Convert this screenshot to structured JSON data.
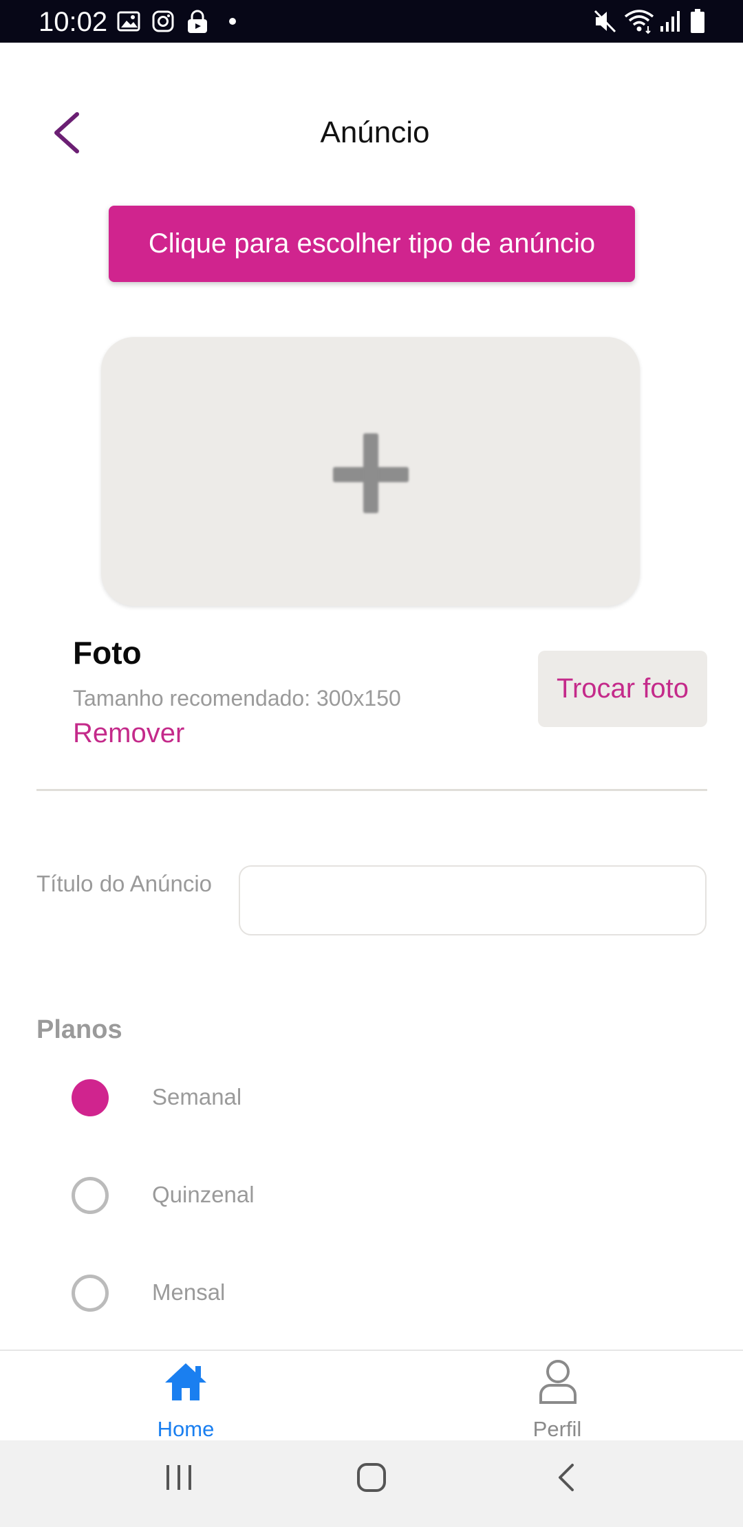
{
  "status_bar": {
    "time": "10:02",
    "left_icons": [
      "image-icon",
      "instagram-icon",
      "lock-icon",
      "dot-icon"
    ],
    "right_icons": [
      "mute-icon",
      "wifi-icon",
      "signal-icon",
      "battery-icon"
    ]
  },
  "header": {
    "title": "Anúncio",
    "back_icon": "chevron-left-icon"
  },
  "type_button": {
    "label": "Clique para escolher tipo de anúncio"
  },
  "photo": {
    "placeholder_icon": "plus-icon",
    "title": "Foto",
    "recommended_size": "Tamanho recomendado: 300x150",
    "remove_label": "Remover",
    "change_label": "Trocar foto"
  },
  "form": {
    "title_label": "Título do Anúncio",
    "title_value": "",
    "title_placeholder": ""
  },
  "plans": {
    "label": "Planos",
    "options": [
      {
        "label": "Semanal",
        "selected": true
      },
      {
        "label": "Quinzenal",
        "selected": false
      },
      {
        "label": "Mensal",
        "selected": false
      }
    ]
  },
  "bottom_nav": {
    "items": [
      {
        "label": "Home",
        "icon": "home-icon",
        "active": true
      },
      {
        "label": "Perfil",
        "icon": "user-icon",
        "active": false
      }
    ]
  },
  "colors": {
    "accent": "#d0248e",
    "accent_text": "#c42a8a",
    "active_nav": "#1a7ff0",
    "back_arrow": "#6b1f73"
  }
}
